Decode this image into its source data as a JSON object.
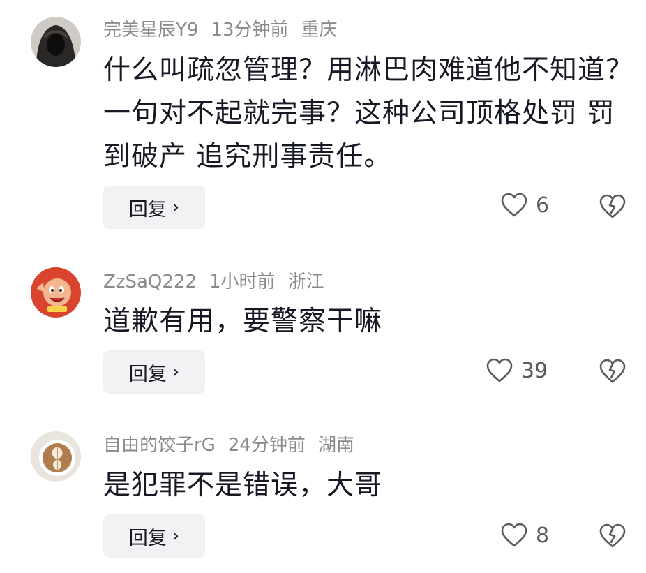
{
  "comments": [
    {
      "username": "完美星辰Y9",
      "time": "13分钟前",
      "location": "重庆",
      "text": "什么叫疏忽管理？用淋巴肉难道他不知道？一句对不起就完事？这种公司顶格处罚 罚到破产 追究刑事责任。",
      "reply_label": "回复",
      "likes": "6",
      "avatar_icon": "hooded-figure-avatar"
    },
    {
      "username": "ZzSaQ222",
      "time": "1小时前",
      "location": "浙江",
      "text": "道歉有用，要警察干嘛",
      "reply_label": "回复",
      "likes": "39",
      "avatar_icon": "cartoon-character-avatar"
    },
    {
      "username": "自由的饺子rG",
      "time": "24分钟前",
      "location": "湖南",
      "text": "是犯罪不是错误，大哥",
      "reply_label": "回复",
      "likes": "8",
      "avatar_icon": "latte-art-avatar"
    }
  ],
  "colors": {
    "meta_text": "#8a8a8f",
    "body_text": "#161823",
    "reply_bg": "#f2f2f4"
  }
}
